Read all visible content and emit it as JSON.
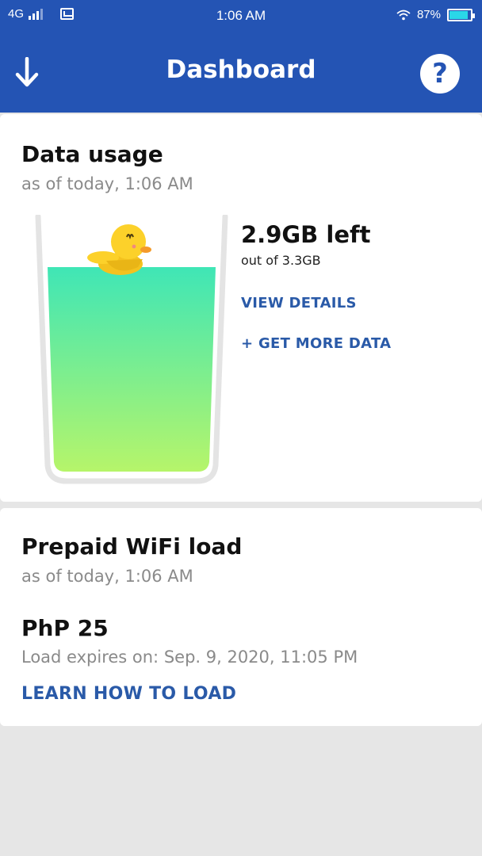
{
  "status_bar": {
    "network": "4G",
    "time": "1:06 AM",
    "battery": "87%",
    "battery_level": 0.87,
    "icons": [
      "signal-icon",
      "message-icon",
      "wifi-icon",
      "battery-icon"
    ]
  },
  "app_bar": {
    "title": "Dashboard",
    "back_icon": "arrow-down-icon",
    "help_icon": "help-icon",
    "help_glyph": "?"
  },
  "data_usage": {
    "title": "Data usage",
    "as_of": "as of today, 1:06 AM",
    "remaining": "2.9GB left",
    "total": "out of 3.3GB",
    "remaining_fraction": 0.879,
    "view_details": "VIEW DETAILS",
    "get_more": "+ GET MORE DATA"
  },
  "wifi_load": {
    "title": "Prepaid WiFi load",
    "as_of": "as of today, 1:06 AM",
    "balance": "PhP 25",
    "expires": "Load expires on: Sep. 9, 2020, 11:05 PM",
    "learn_link": "LEARN HOW TO LOAD"
  },
  "colors": {
    "primary": "#2454b4",
    "link": "#2a5aa8",
    "liquid_top": "#3fe6b6",
    "liquid_bottom": "#b6f56a",
    "duck": "#fcd12a"
  }
}
